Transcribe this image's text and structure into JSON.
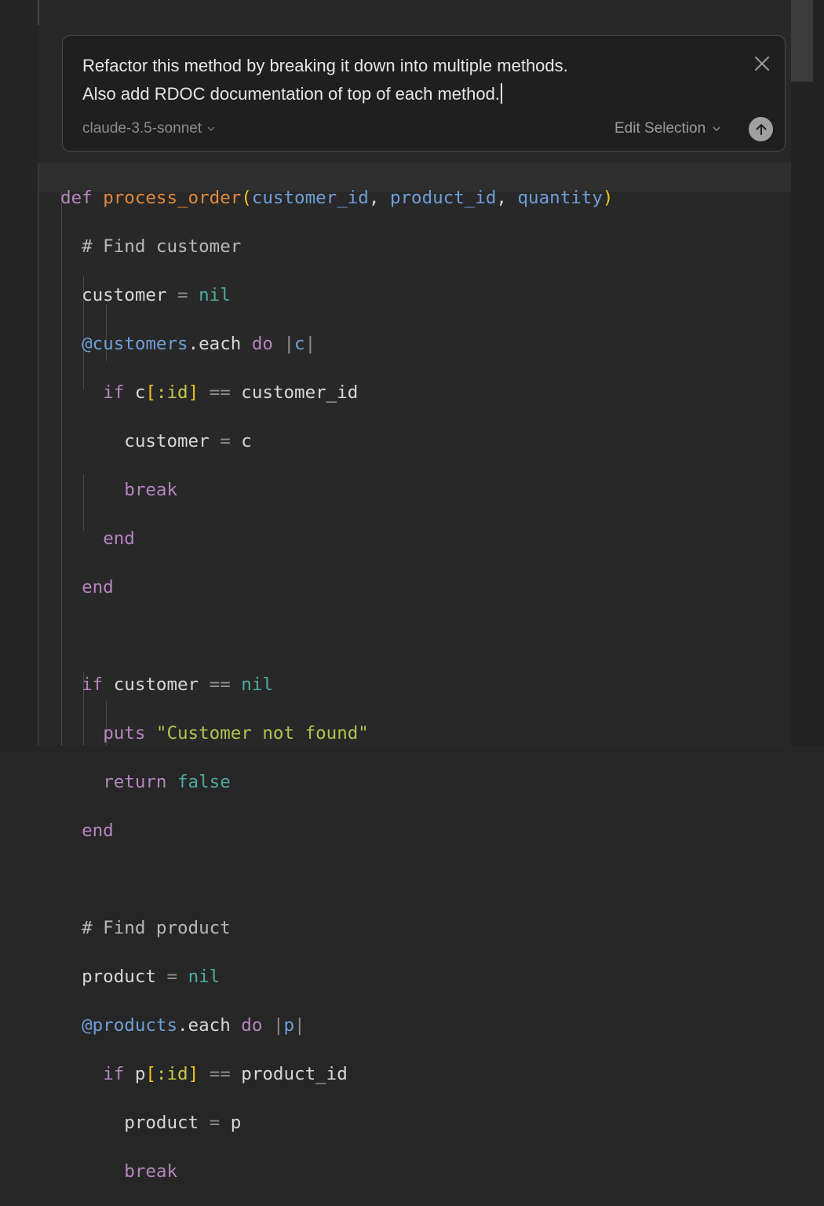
{
  "prompt": {
    "line1": "Refactor this method by breaking it down into multiple methods.",
    "line2": "Also add RDOC documentation of top of each method.",
    "model": "claude-3.5-sonnet",
    "mode": "Edit Selection",
    "close_icon": "close-icon",
    "submit_icon": "arrow-up-icon"
  },
  "code": {
    "def_kw": "def",
    "method_name": "process_order",
    "param1": "customer_id",
    "param2": "product_id",
    "param3": "quantity",
    "comment_customer": "# Find customer",
    "customer_var": "customer",
    "nil": "nil",
    "customers_ivar": "@customers",
    "each": ".each",
    "do": "do",
    "block_c": "c",
    "if": "if",
    "c_var": "c",
    "id_sym": ":id",
    "eqeq": "==",
    "customer_id": "customer_id",
    "break": "break",
    "end": "end",
    "puts": "puts",
    "str_customer_not_found": "\"Customer not found\"",
    "return": "return",
    "false": "false",
    "comment_product": "# Find product",
    "product_var": "product",
    "products_ivar": "@products",
    "block_p": "p",
    "p_var": "p",
    "product_id": "product_id",
    "assign": "="
  }
}
